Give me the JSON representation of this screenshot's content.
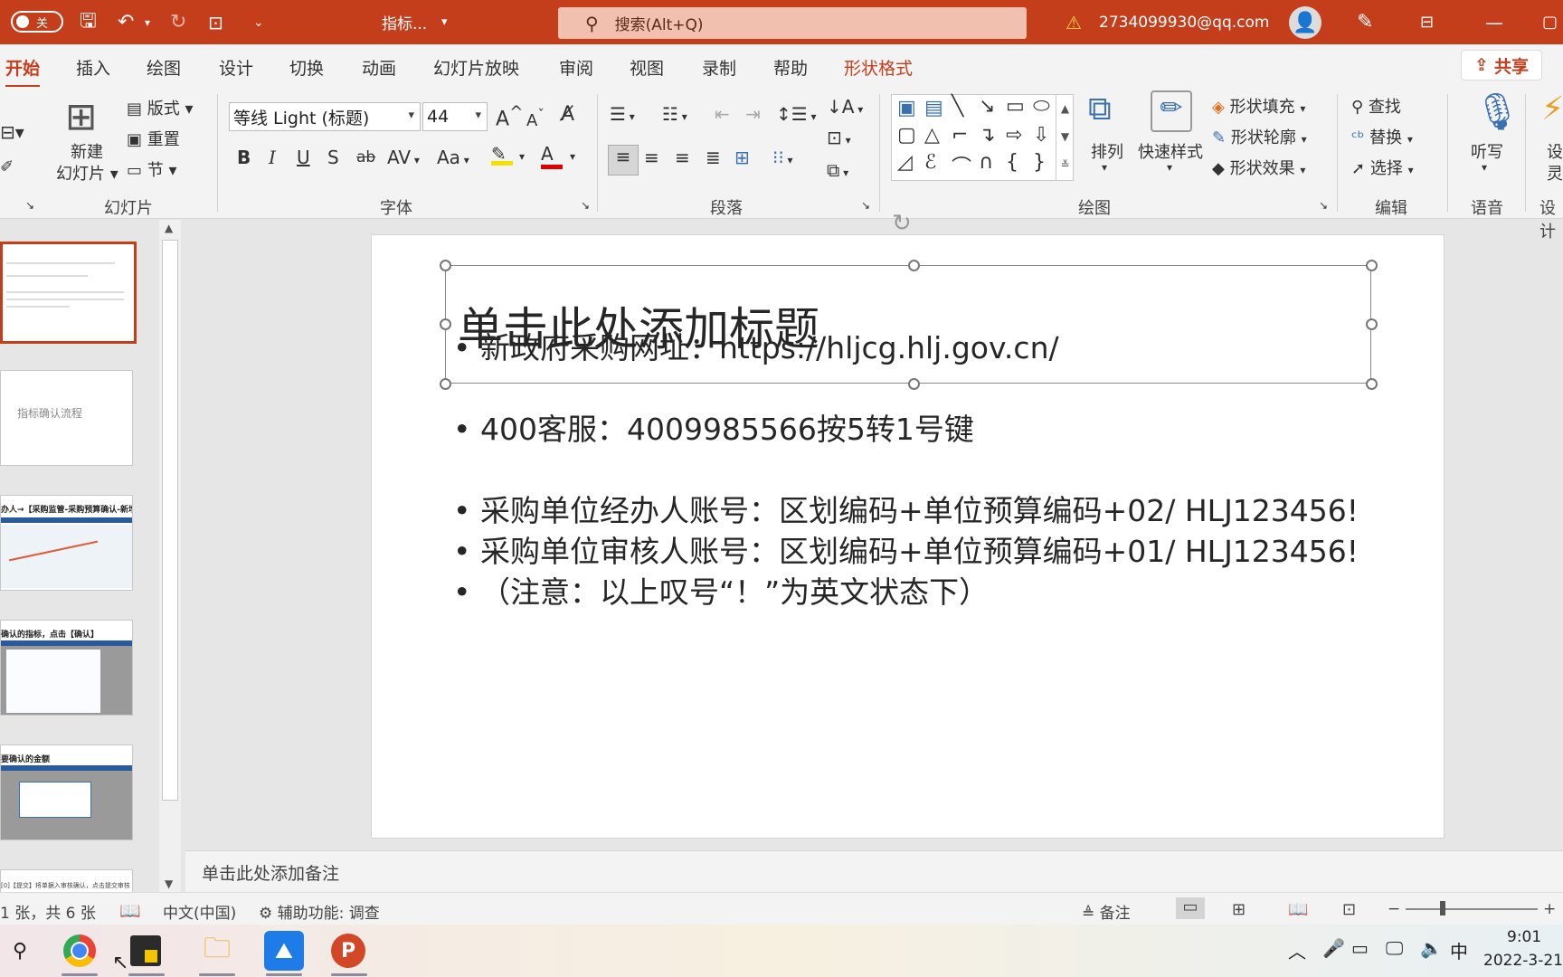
{
  "titlebar": {
    "autosave_label": "关",
    "doc_title": "指标...",
    "search_placeholder": "搜索(Alt+Q)",
    "warning_icon": "warning-icon",
    "account": "2734099930@qq.com"
  },
  "tabs": [
    "开始",
    "插入",
    "绘图",
    "设计",
    "切换",
    "动画",
    "幻灯片放映",
    "审阅",
    "视图",
    "录制",
    "帮助",
    "形状格式"
  ],
  "share_label": "共享",
  "ribbon": {
    "slides": {
      "new_slide_1": "新建",
      "new_slide_2": "幻灯片",
      "layout": "版式",
      "reset": "重置",
      "section": "节",
      "group": "幻灯片"
    },
    "font": {
      "name": "等线 Light (标题)",
      "size": "44",
      "bold": "B",
      "italic": "I",
      "underline": "U",
      "shadow": "S",
      "strike": "ab",
      "spacing": "AV",
      "case": "Aa",
      "grow": "A",
      "shrink": "A",
      "group": "字体"
    },
    "paragraph": {
      "group": "段落"
    },
    "drawing": {
      "arrange": "排列",
      "quick_styles": "快速样式",
      "shape_fill": "形状填充",
      "shape_outline": "形状轮廓",
      "shape_effects": "形状效果",
      "group": "绘图"
    },
    "editing": {
      "find": "查找",
      "replace": "替换",
      "select": "选择",
      "group": "编辑"
    },
    "voice": {
      "dictate": "听写",
      "group": "语音"
    },
    "designer": {
      "label_1": "设",
      "label_2": "灵",
      "group": "设计"
    }
  },
  "thumbnails": {
    "slide2_text": "指标确认流程",
    "slide3_text": "办人→【采购监管-采购预算确认-新增】",
    "slide4_text": "确认的指标，点击【确认】",
    "slide5_text": "要确认的金额",
    "slide6_text": "[0]【提交】将单据入审核确认，点击提交审核"
  },
  "slide": {
    "title_placeholder": "单击此处添加标题",
    "bullets": [
      "新政府采购网址：https://hljcg.hlj.gov.cn/",
      "400客服：4009985566按5转1号键",
      "采购单位经办人账号：区划编码+单位预算编码+02/ HLJ123456!",
      "采购单位审核人账号：区划编码+单位预算编码+01/ HLJ123456!",
      "（注意：以上叹号“！”为英文状态下）"
    ]
  },
  "notes_placeholder": "单击此处添加备注",
  "status": {
    "slide_count": "1 张，共 6 张",
    "language": "中文(中国)",
    "accessibility": "辅助功能: 调查",
    "notes": "备注",
    "zoom_minus": "−",
    "zoom_plus": "+"
  },
  "taskbar": {
    "ime": "中",
    "time": "9:01",
    "date": "2022-3-21"
  },
  "colors": {
    "accent": "#c43e1c",
    "ribbon_bg": "#f3f3f3"
  }
}
